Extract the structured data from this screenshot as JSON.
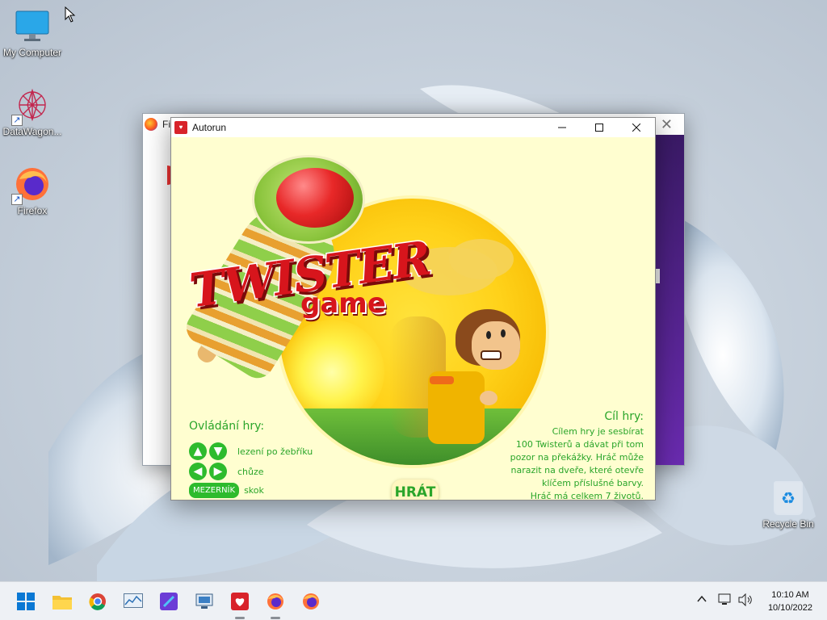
{
  "desktop": {
    "icons": [
      {
        "label": "My Computer"
      },
      {
        "label": "DataWagon..."
      },
      {
        "label": "Firefox"
      }
    ],
    "recycle_bin": {
      "label": "Recycle Bin"
    }
  },
  "firefox_window": {
    "title": "Fi"
  },
  "autorun": {
    "title": "Autorun",
    "logo": {
      "word": "TWISTER",
      "sub": "game"
    },
    "controls": {
      "title": "Ovládání hry:",
      "rows": [
        {
          "label": "lezení po žebříku"
        },
        {
          "label": "chůze"
        },
        {
          "key": "MEZERNÍK",
          "label": "skok"
        }
      ]
    },
    "goal": {
      "title": "Cíl hry:",
      "lines": [
        "Cílem hry je sesbírat",
        "100 Twisterů a dávat při tom",
        "pozor na překážky. Hráč může",
        "narazit na dveře, které otevře",
        "klíčem příslušné barvy.",
        "Hráč má celkem 7 životů."
      ]
    },
    "play_label": "HRÁT"
  },
  "taskbar": {
    "clock": {
      "time": "10:10 AM",
      "date": "10/10/2022"
    }
  },
  "colors": {
    "accent_green": "#2aa52a",
    "brand_red": "#d7151c",
    "panel_bg": "#fffed0"
  }
}
